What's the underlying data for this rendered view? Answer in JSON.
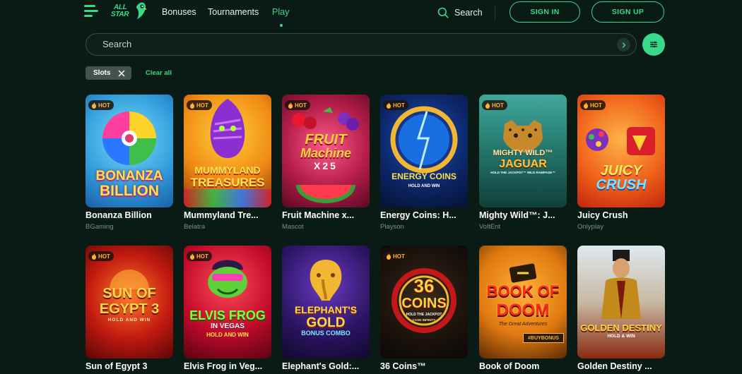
{
  "brand": {
    "logo_line1": "ALL",
    "logo_line2": "STAR"
  },
  "nav": {
    "items": [
      {
        "label": "Bonuses"
      },
      {
        "label": "Tournaments"
      },
      {
        "label": "Play",
        "active": true
      }
    ],
    "search_label": "Search",
    "sign_in": "SIGN IN",
    "sign_up": "SIGN UP"
  },
  "search": {
    "placeholder": "Search"
  },
  "filters": {
    "active_chip": "Slots",
    "clear_all": "Clear all"
  },
  "hot_label": "HOT",
  "colors": {
    "background": "#0a1a14",
    "accent": "#39d98a",
    "hot": "#ffb13b"
  },
  "games": [
    {
      "title": "Bonanza Billion",
      "provider": "BGaming",
      "hot": true
    },
    {
      "title": "Mummyland Tre...",
      "provider": "Belatra",
      "hot": true
    },
    {
      "title": "Fruit Machine x...",
      "provider": "Mascot",
      "hot": true
    },
    {
      "title": "Energy Coins: H...",
      "provider": "Playson",
      "hot": true
    },
    {
      "title": "Mighty Wild™: J...",
      "provider": "VoltEnt",
      "hot": true
    },
    {
      "title": "Juicy Crush",
      "provider": "Onlyplay",
      "hot": true
    },
    {
      "title": "Sun of Egypt 3",
      "provider": "",
      "hot": true
    },
    {
      "title": "Elvis Frog in Veg...",
      "provider": "",
      "hot": true
    },
    {
      "title": "Elephant's Gold:...",
      "provider": "",
      "hot": false
    },
    {
      "title": "36 Coins™",
      "provider": "",
      "hot": true
    },
    {
      "title": "Book of Doom",
      "provider": "",
      "hot": false
    },
    {
      "title": "Golden Destiny ...",
      "provider": "",
      "hot": false
    }
  ],
  "thumb_art": [
    {
      "lines": [
        "BONANZA",
        "BILLION"
      ]
    },
    {
      "lines": [
        "MUMMYLAND",
        "TREASURES"
      ]
    },
    {
      "lines": [
        "FRUIT",
        "Machine",
        "X25"
      ]
    },
    {
      "lines": [
        "ENERGY COINS",
        "HOLD AND WIN"
      ]
    },
    {
      "lines": [
        "MIGHTY WILD™",
        "JAGUAR",
        "HOLD THE JACKPOT™ WILD RAMPAGE™"
      ]
    },
    {
      "lines": [
        "JUICY",
        "CRUSH"
      ]
    },
    {
      "lines": [
        "SUN OF",
        "EGYPT 3",
        "HOLD AND WIN"
      ]
    },
    {
      "lines": [
        "ELVIS FROG",
        "IN VEGAS",
        "HOLD AND WIN"
      ]
    },
    {
      "lines": [
        "ELEPHANT'S",
        "GOLD",
        "BONUS COMBO"
      ]
    },
    {
      "lines": [
        "36",
        "COINS",
        "HOLD THE JACKPOT",
        "CASH INFINITY"
      ]
    },
    {
      "lines": [
        "BOOK OF",
        "DOOM",
        "The Great Adventures",
        "#BUYBONUS"
      ]
    },
    {
      "lines": [
        "GOLDEN DESTINY",
        "HOLD & WIN"
      ]
    }
  ]
}
